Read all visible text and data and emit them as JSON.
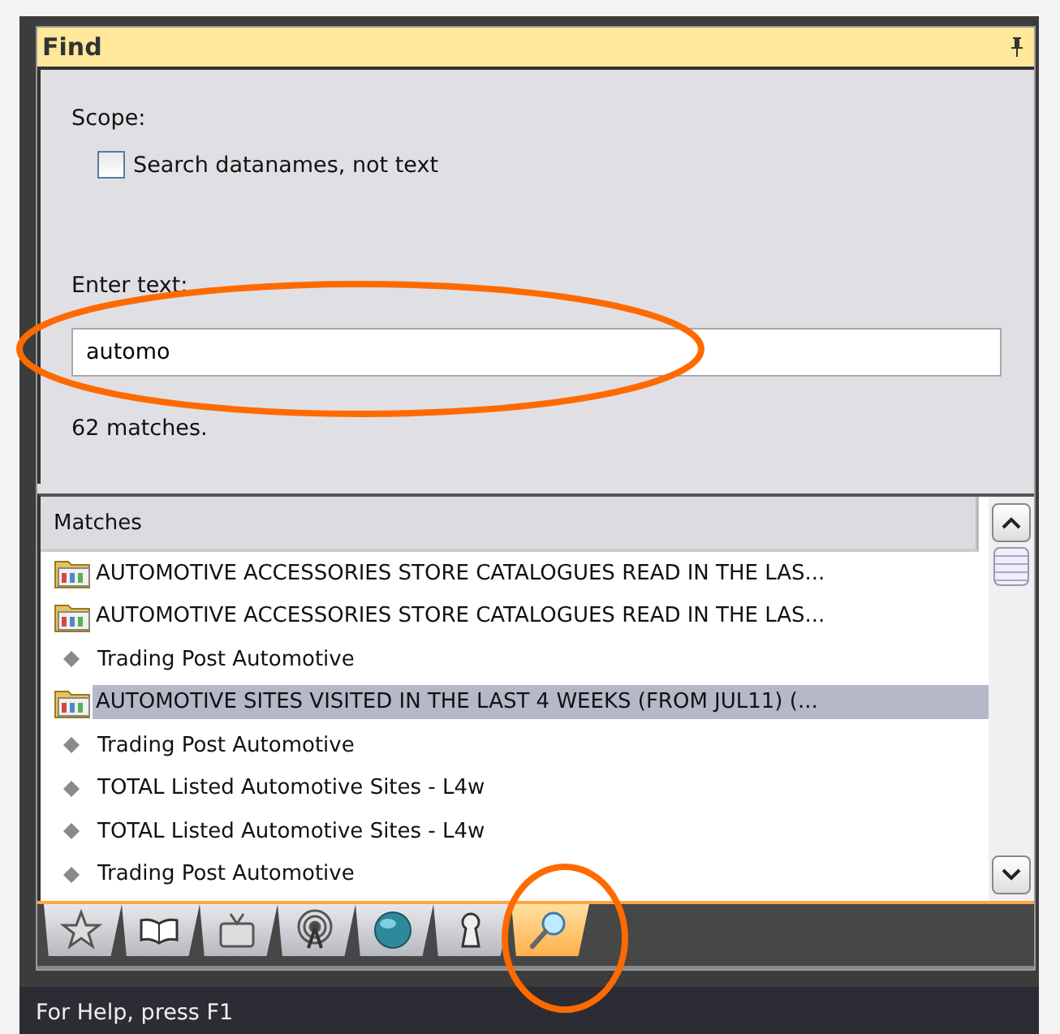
{
  "panel": {
    "title": "Find"
  },
  "scope": {
    "label": "Scope:",
    "checkbox": {
      "label": "Search datanames, not text",
      "checked": false
    }
  },
  "search": {
    "label": "Enter text:",
    "value": "automo",
    "result": "62 matches."
  },
  "matches": {
    "header": "Matches",
    "rows": [
      {
        "kind": "folder",
        "text": "AUTOMOTIVE ACCESSORIES STORE CATALOGUES READ IN THE LAS...",
        "selected": false
      },
      {
        "kind": "folder",
        "text": "AUTOMOTIVE ACCESSORIES STORE CATALOGUES READ IN THE LAS...",
        "selected": false
      },
      {
        "kind": "item",
        "text": "Trading Post Automotive",
        "selected": false
      },
      {
        "kind": "folder",
        "text": "AUTOMOTIVE SITES VISITED IN THE LAST 4 WEEKS (FROM JUL11) (...",
        "selected": true
      },
      {
        "kind": "item",
        "text": "Trading Post Automotive",
        "selected": false
      },
      {
        "kind": "item",
        "text": "TOTAL Listed Automotive Sites - L4w",
        "selected": false
      },
      {
        "kind": "item",
        "text": "TOTAL Listed Automotive Sites - L4w",
        "selected": false
      },
      {
        "kind": "item",
        "text": "Trading Post Automotive",
        "selected": false
      }
    ]
  },
  "tabs": [
    {
      "kind": "star",
      "selected": false
    },
    {
      "kind": "book",
      "selected": false
    },
    {
      "kind": "tv",
      "selected": false
    },
    {
      "kind": "antenna",
      "selected": false
    },
    {
      "kind": "globe",
      "selected": false
    },
    {
      "kind": "keyhole",
      "selected": false
    },
    {
      "kind": "search",
      "selected": true
    }
  ],
  "status_bar": {
    "text": "For Help, press F1"
  }
}
